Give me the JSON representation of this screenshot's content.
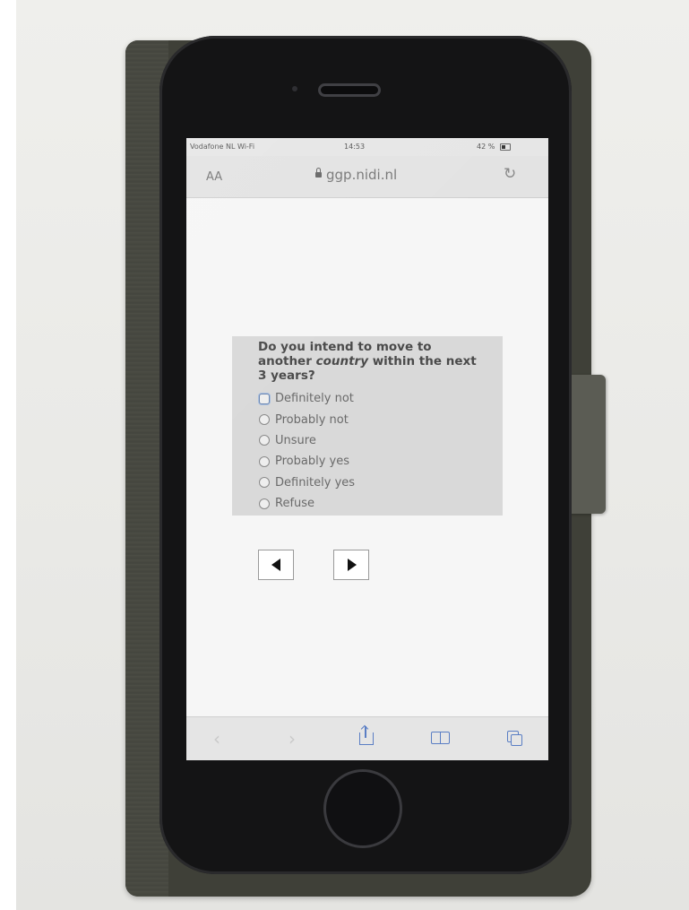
{
  "status_bar": {
    "carrier": "Vodafone NL Wi-Fi",
    "time": "14:53",
    "battery": "42 %"
  },
  "browser": {
    "text_size_label": "AA",
    "url": "ggp.nidi.nl",
    "reload_icon": "reload-icon"
  },
  "survey": {
    "question_prefix": "Do you intend to move to another ",
    "question_emphasis": "country",
    "question_suffix": " within the next 3 years?",
    "options": [
      {
        "label": "Definitely not",
        "focused": true
      },
      {
        "label": "Probably not",
        "focused": false
      },
      {
        "label": "Unsure",
        "focused": false
      },
      {
        "label": "Probably yes",
        "focused": false
      },
      {
        "label": "Definitely yes",
        "focused": false
      },
      {
        "label": "Refuse",
        "focused": false
      }
    ]
  },
  "navigation": {
    "prev_icon": "triangle-left-icon",
    "next_icon": "triangle-right-icon"
  },
  "toolbar": {
    "back_icon": "chevron-left-icon",
    "forward_icon": "chevron-right-icon",
    "share_icon": "share-icon",
    "bookmarks_icon": "book-icon",
    "tabs_icon": "tabs-icon",
    "accent_color": "#5a7ec4"
  }
}
